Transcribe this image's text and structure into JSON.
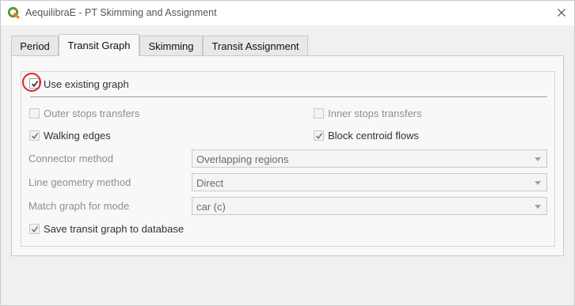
{
  "window": {
    "title": "AequilibraE - PT Skimming and Assignment",
    "icon": "qgis-logo-icon",
    "accent_color": "#589632"
  },
  "tabs": [
    {
      "label": "Period",
      "active": false
    },
    {
      "label": "Transit Graph",
      "active": true
    },
    {
      "label": "Skimming",
      "active": false
    },
    {
      "label": "Transit Assignment",
      "active": false
    }
  ],
  "transit_graph": {
    "use_existing": {
      "label": "Use existing graph",
      "checked": true
    },
    "outer_stops": {
      "label": "Outer stops transfers",
      "checked": false,
      "enabled": false
    },
    "inner_stops": {
      "label": "Inner stops transfers",
      "checked": false,
      "enabled": false
    },
    "walking_edges": {
      "label": "Walking edges",
      "checked": true,
      "enabled": false
    },
    "block_centroid": {
      "label": "Block centroid flows",
      "checked": true,
      "enabled": false
    },
    "connector_method": {
      "label": "Connector method",
      "value": "Overlapping regions"
    },
    "line_geometry": {
      "label": "Line geometry method",
      "value": "Direct"
    },
    "match_mode": {
      "label": "Match graph for mode",
      "value": "car (c)"
    },
    "save_graph": {
      "label": "Save transit graph to database",
      "checked": true,
      "enabled": false
    }
  },
  "colors": {
    "highlight_ring": "#d9262d"
  }
}
